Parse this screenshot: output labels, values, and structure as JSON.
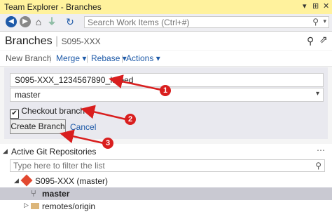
{
  "window": {
    "title": "Team Explorer - Branches",
    "controls": [
      "▾",
      "⊞",
      "✕"
    ]
  },
  "toolbar": {
    "search_placeholder": "Search Work Items (Ctrl+#)",
    "icons": [
      "back-icon",
      "forward-icon",
      "home-icon",
      "plug-icon",
      "refresh-icon"
    ]
  },
  "header": {
    "title": "Branches",
    "separator": "|",
    "subtitle": "S095-XXX"
  },
  "actions": {
    "new_branch": "New Branch",
    "merge": "Merge",
    "rebase": "Rebase",
    "actions": "Actions"
  },
  "form": {
    "branch_name": "S095-XXX_1234567890_Infeed",
    "base_branch": "master",
    "checkout_label": "Checkout branch",
    "checkout_checked": true,
    "create_label": "Create Branch",
    "cancel_label": "Cancel"
  },
  "repos": {
    "title": "Active Git Repositories",
    "filter_placeholder": "Type here to filter the list",
    "items": [
      {
        "label": "S095-XXX (master)"
      },
      {
        "label": "master"
      },
      {
        "label": "remotes/origin"
      }
    ]
  },
  "annotations": [
    "1",
    "2",
    "3"
  ],
  "colors": {
    "title_bar": "#fff29d",
    "link": "#1e5aa8",
    "annotation": "#d91e1e",
    "selected_row": "#c9c9d2"
  }
}
